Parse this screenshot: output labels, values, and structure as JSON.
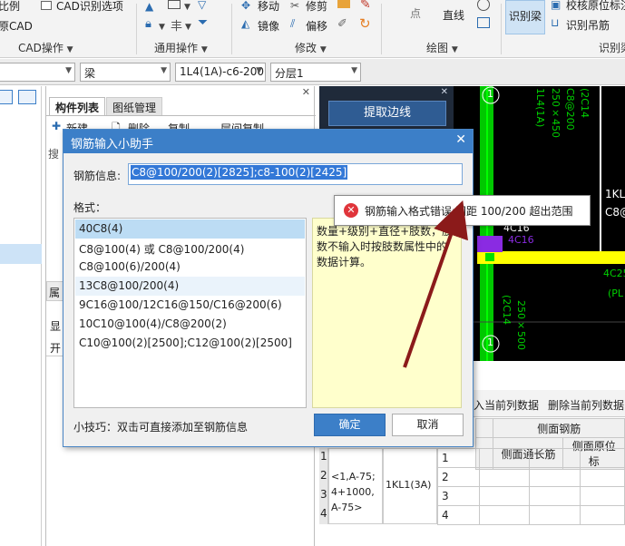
{
  "ribbon": {
    "row1_left_a": "比例",
    "row1_left_b": "CAD识别选项",
    "row2_left": "原CAD",
    "group_cad_ops": "CAD操作",
    "group_general_ops": "通用操作",
    "group_modify": "修改",
    "group_draw": "绘图",
    "group_identify": "识别梁",
    "move": "移动",
    "trim": "修剪",
    "mirror": "镜像",
    "offset": "偏移",
    "point": "点",
    "line": "直线",
    "identify_beam": "识别梁",
    "verify_original": "校核原位标注",
    "identify_hanger": "识别吊筋"
  },
  "propbar": {
    "combo1_value": "",
    "combo2_value": "梁",
    "combo3_value": "1L4(1A)-c6-200",
    "combo4_value": "分层1"
  },
  "component_panel": {
    "tab_list": "构件列表",
    "tab_drawings": "图纸管理",
    "toolbar_new": "新建",
    "toolbar_delete": "删除",
    "toolbar_copy": "复制",
    "toolbar_layer_copy": "层间复制",
    "search_label": "搜",
    "prop_label": "属",
    "show_label": "显",
    "open_label": "开"
  },
  "cad_side": {
    "extract_edge": "提取边线"
  },
  "cad_texts": {
    "t1": "1L4(1A)",
    "t2": "250×450",
    "t3": "C8@200",
    "t4": "(2C14",
    "t5": "1KL",
    "t6": "C8@",
    "t7": "4C16",
    "t8": "4C16",
    "t9": "4C25",
    "t10": "(PL",
    "t11": "(2C14",
    "t12": "250×500",
    "axis1": "1",
    "axis2": "1"
  },
  "grid": {
    "toolbar_insert": "入当前列数据",
    "toolbar_delete": "删除当前列数据",
    "header_side": "侧面钢筋",
    "header_side_cont": "侧面通长筋",
    "header_side_orig": "侧面原位标",
    "row_nums": [
      "1",
      "2",
      "3",
      "4"
    ],
    "location": "<1,A-75;\n4+1000,\nA-75>",
    "component": "1KL1(3A)",
    "sub_rows": [
      "1",
      "2",
      "3",
      "4"
    ]
  },
  "dialog": {
    "title": "钢筋输入小助手",
    "rebar_label": "钢筋信息:",
    "rebar_value": "C8@100/200(2)[2825];c8-100(2)[2425]",
    "format_label": "格式：",
    "formats": [
      "40C8(4)",
      "C8@100(4) 或 C8@100/200(4)",
      "C8@100(6)/200(4)",
      "13C8@100/200(4)",
      "9C16@100/12C16@150/C16@200(6)",
      "10C10@100(4)/C8@200(2)",
      "C10@100(2)[2500];C12@100(2)[2500]"
    ],
    "note": "数量+级别+直径+肢数，肢数不输入时按肢数属性中的数据计算。",
    "tip": "小技巧：双击可直接添加至钢筋信息",
    "ok": "确定",
    "cancel": "取消"
  },
  "error_tip": {
    "message": "钢筋输入格式错误:间距 100/200 超出范围"
  }
}
